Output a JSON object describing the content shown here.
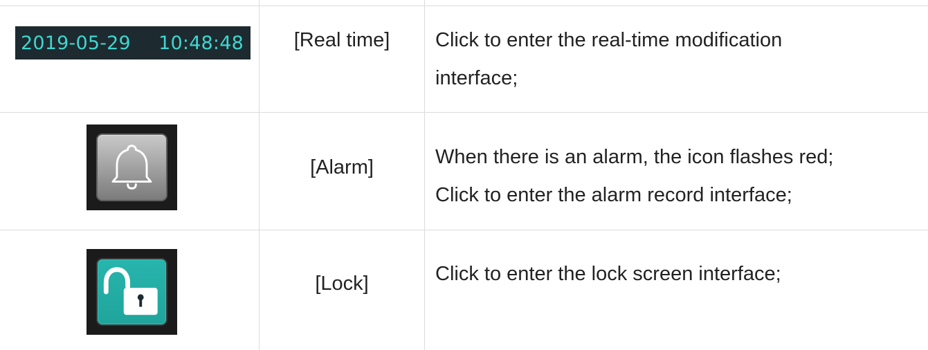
{
  "rows": [
    {
      "widget": {
        "date": "2019-05-29",
        "time": "10:48:48",
        "icon": "datetime-display"
      },
      "label": "[Real time]",
      "desc_lines": [
        "Click to enter the real-time modification",
        "interface;"
      ]
    },
    {
      "widget": {
        "icon": "bell-icon"
      },
      "label": "[Alarm]",
      "desc_lines": [
        "When there is an alarm, the icon flashes red;",
        "Click to enter the alarm record interface;"
      ]
    },
    {
      "widget": {
        "icon": "unlocked-padlock-icon"
      },
      "label": "[Lock]",
      "desc_lines": [
        "Click to enter the lock screen interface;"
      ]
    }
  ],
  "colors": {
    "datetime_bg": "#1d2a2f",
    "datetime_text": "#3fd6d0",
    "bell_tile": "#9e9e9e",
    "lock_tile": "#1fa49b",
    "grid": "#dcdcdc",
    "text": "#222222"
  }
}
